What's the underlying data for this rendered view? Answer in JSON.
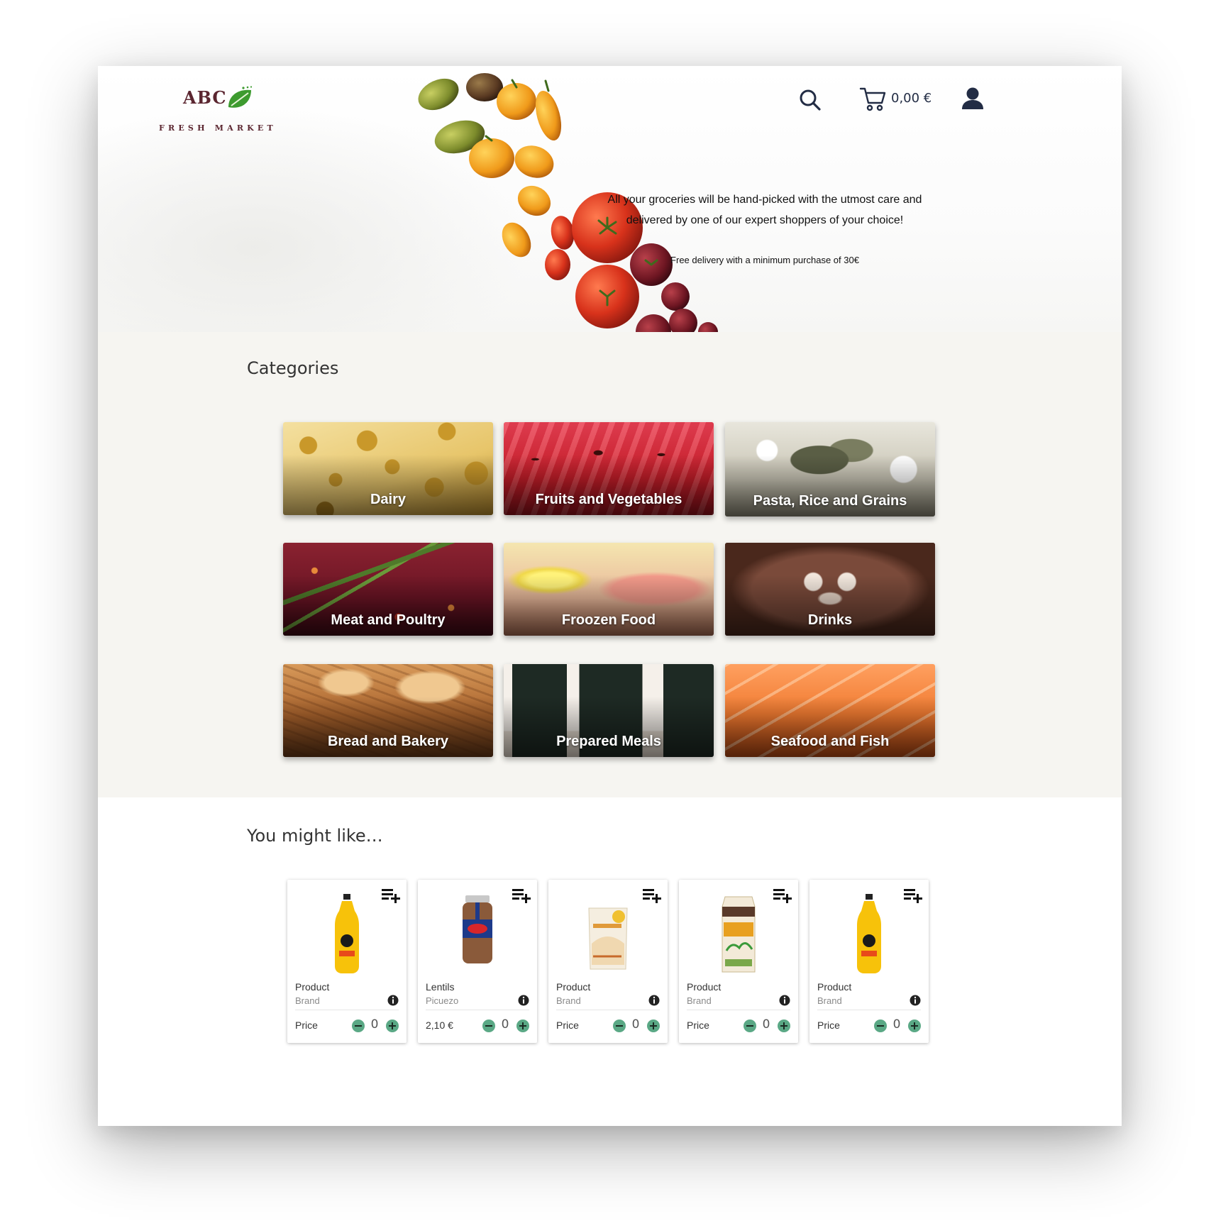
{
  "brand": {
    "name": "ABC",
    "subtitle": "FRESH MARKET",
    "color": "#5b2630",
    "leaf_color": "#3d9b2f"
  },
  "header": {
    "cart_total": "0,00 €",
    "icons": [
      "search-icon",
      "cart-icon",
      "user-icon"
    ]
  },
  "hero": {
    "tagline_line1": "All your groceries will be hand-picked with the utmost care and",
    "tagline_line2": "delivered by one of our expert shoppers of your choice!",
    "delivery_note": "Free delivery with a minimum purchase of 30€"
  },
  "categories": {
    "title": "Categories",
    "items": [
      {
        "label": "Dairy"
      },
      {
        "label": "Fruits and Vegetables"
      },
      {
        "label": "Pasta, Rice and Grains"
      },
      {
        "label": "Meat and Poultry"
      },
      {
        "label": "Froozen Food"
      },
      {
        "label": "Drinks"
      },
      {
        "label": "Bread and Bakery"
      },
      {
        "label": "Prepared Meals"
      },
      {
        "label": "Seafood and Fish"
      }
    ]
  },
  "recommendations": {
    "title": "You might like…",
    "products": [
      {
        "name": "Product",
        "brand": "Brand",
        "price": "Price",
        "qty": "0",
        "image": "orange-juice-bottle"
      },
      {
        "name": "Lentils",
        "brand": "Picuezo",
        "price": "2,10 €",
        "qty": "0",
        "image": "lentils-jar"
      },
      {
        "name": "Product",
        "brand": "Brand",
        "price": "Price",
        "qty": "0",
        "image": "bag"
      },
      {
        "name": "Product",
        "brand": "Brand",
        "price": "Price",
        "qty": "0",
        "image": "oat-milk-carton"
      },
      {
        "name": "Product",
        "brand": "Brand",
        "price": "Price",
        "qty": "0",
        "image": "orange-juice-bottle"
      }
    ]
  },
  "colors": {
    "accent_green": "#5aa885",
    "navy": "#222c44",
    "section_bg": "#f6f5f1"
  }
}
